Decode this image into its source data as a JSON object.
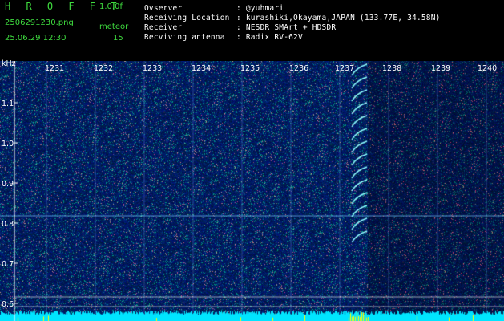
{
  "app": {
    "title": "H R O F F T",
    "version": "1.0.0f"
  },
  "file": {
    "name": "2506291230.png",
    "datetime": "25.06.29 12:30"
  },
  "counter": {
    "label": "meteor",
    "value": "15"
  },
  "info": {
    "observer_label": "Ovserver",
    "observer_value": ": @yuhmari",
    "location_label": "Receiving Location",
    "location_value": ": kurashiki,Okayama,JAPAN (133.77E, 34.58N)",
    "receiver_label": "Receiver",
    "receiver_value": ": NESDR SMArt + HDSDR",
    "antenna_label": "Recviving antenna",
    "antenna_value": ": Radix RV-62V"
  },
  "axis": {
    "unit": "kHz",
    "y_ticks": [
      "1.1",
      "1.0",
      "0.9",
      "0.8",
      "0.7",
      "0.6"
    ],
    "x_ticks": [
      "1231",
      "1232",
      "1233",
      "1234",
      "1235",
      "1236",
      "1237",
      "1238",
      "1239",
      "1240"
    ]
  },
  "colors": {
    "background": "#000000",
    "waterfall": "#0a1a6e",
    "accent": "#3fdc3f",
    "signal": "#00e5ff",
    "burst": "#ffff00"
  }
}
